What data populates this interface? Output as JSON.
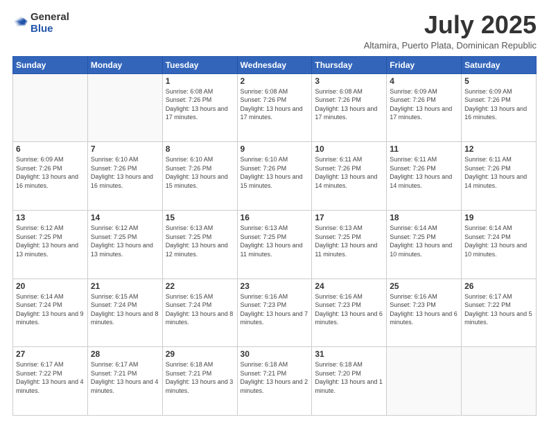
{
  "header": {
    "logo_general": "General",
    "logo_blue": "Blue",
    "month_title": "July 2025",
    "subtitle": "Altamira, Puerto Plata, Dominican Republic"
  },
  "weekdays": [
    "Sunday",
    "Monday",
    "Tuesday",
    "Wednesday",
    "Thursday",
    "Friday",
    "Saturday"
  ],
  "weeks": [
    [
      {
        "day": "",
        "info": ""
      },
      {
        "day": "",
        "info": ""
      },
      {
        "day": "1",
        "info": "Sunrise: 6:08 AM\nSunset: 7:26 PM\nDaylight: 13 hours and 17 minutes."
      },
      {
        "day": "2",
        "info": "Sunrise: 6:08 AM\nSunset: 7:26 PM\nDaylight: 13 hours and 17 minutes."
      },
      {
        "day": "3",
        "info": "Sunrise: 6:08 AM\nSunset: 7:26 PM\nDaylight: 13 hours and 17 minutes."
      },
      {
        "day": "4",
        "info": "Sunrise: 6:09 AM\nSunset: 7:26 PM\nDaylight: 13 hours and 17 minutes."
      },
      {
        "day": "5",
        "info": "Sunrise: 6:09 AM\nSunset: 7:26 PM\nDaylight: 13 hours and 16 minutes."
      }
    ],
    [
      {
        "day": "6",
        "info": "Sunrise: 6:09 AM\nSunset: 7:26 PM\nDaylight: 13 hours and 16 minutes."
      },
      {
        "day": "7",
        "info": "Sunrise: 6:10 AM\nSunset: 7:26 PM\nDaylight: 13 hours and 16 minutes."
      },
      {
        "day": "8",
        "info": "Sunrise: 6:10 AM\nSunset: 7:26 PM\nDaylight: 13 hours and 15 minutes."
      },
      {
        "day": "9",
        "info": "Sunrise: 6:10 AM\nSunset: 7:26 PM\nDaylight: 13 hours and 15 minutes."
      },
      {
        "day": "10",
        "info": "Sunrise: 6:11 AM\nSunset: 7:26 PM\nDaylight: 13 hours and 14 minutes."
      },
      {
        "day": "11",
        "info": "Sunrise: 6:11 AM\nSunset: 7:26 PM\nDaylight: 13 hours and 14 minutes."
      },
      {
        "day": "12",
        "info": "Sunrise: 6:11 AM\nSunset: 7:26 PM\nDaylight: 13 hours and 14 minutes."
      }
    ],
    [
      {
        "day": "13",
        "info": "Sunrise: 6:12 AM\nSunset: 7:25 PM\nDaylight: 13 hours and 13 minutes."
      },
      {
        "day": "14",
        "info": "Sunrise: 6:12 AM\nSunset: 7:25 PM\nDaylight: 13 hours and 13 minutes."
      },
      {
        "day": "15",
        "info": "Sunrise: 6:13 AM\nSunset: 7:25 PM\nDaylight: 13 hours and 12 minutes."
      },
      {
        "day": "16",
        "info": "Sunrise: 6:13 AM\nSunset: 7:25 PM\nDaylight: 13 hours and 11 minutes."
      },
      {
        "day": "17",
        "info": "Sunrise: 6:13 AM\nSunset: 7:25 PM\nDaylight: 13 hours and 11 minutes."
      },
      {
        "day": "18",
        "info": "Sunrise: 6:14 AM\nSunset: 7:25 PM\nDaylight: 13 hours and 10 minutes."
      },
      {
        "day": "19",
        "info": "Sunrise: 6:14 AM\nSunset: 7:24 PM\nDaylight: 13 hours and 10 minutes."
      }
    ],
    [
      {
        "day": "20",
        "info": "Sunrise: 6:14 AM\nSunset: 7:24 PM\nDaylight: 13 hours and 9 minutes."
      },
      {
        "day": "21",
        "info": "Sunrise: 6:15 AM\nSunset: 7:24 PM\nDaylight: 13 hours and 8 minutes."
      },
      {
        "day": "22",
        "info": "Sunrise: 6:15 AM\nSunset: 7:24 PM\nDaylight: 13 hours and 8 minutes."
      },
      {
        "day": "23",
        "info": "Sunrise: 6:16 AM\nSunset: 7:23 PM\nDaylight: 13 hours and 7 minutes."
      },
      {
        "day": "24",
        "info": "Sunrise: 6:16 AM\nSunset: 7:23 PM\nDaylight: 13 hours and 6 minutes."
      },
      {
        "day": "25",
        "info": "Sunrise: 6:16 AM\nSunset: 7:23 PM\nDaylight: 13 hours and 6 minutes."
      },
      {
        "day": "26",
        "info": "Sunrise: 6:17 AM\nSunset: 7:22 PM\nDaylight: 13 hours and 5 minutes."
      }
    ],
    [
      {
        "day": "27",
        "info": "Sunrise: 6:17 AM\nSunset: 7:22 PM\nDaylight: 13 hours and 4 minutes."
      },
      {
        "day": "28",
        "info": "Sunrise: 6:17 AM\nSunset: 7:21 PM\nDaylight: 13 hours and 4 minutes."
      },
      {
        "day": "29",
        "info": "Sunrise: 6:18 AM\nSunset: 7:21 PM\nDaylight: 13 hours and 3 minutes."
      },
      {
        "day": "30",
        "info": "Sunrise: 6:18 AM\nSunset: 7:21 PM\nDaylight: 13 hours and 2 minutes."
      },
      {
        "day": "31",
        "info": "Sunrise: 6:18 AM\nSunset: 7:20 PM\nDaylight: 13 hours and 1 minute."
      },
      {
        "day": "",
        "info": ""
      },
      {
        "day": "",
        "info": ""
      }
    ]
  ]
}
